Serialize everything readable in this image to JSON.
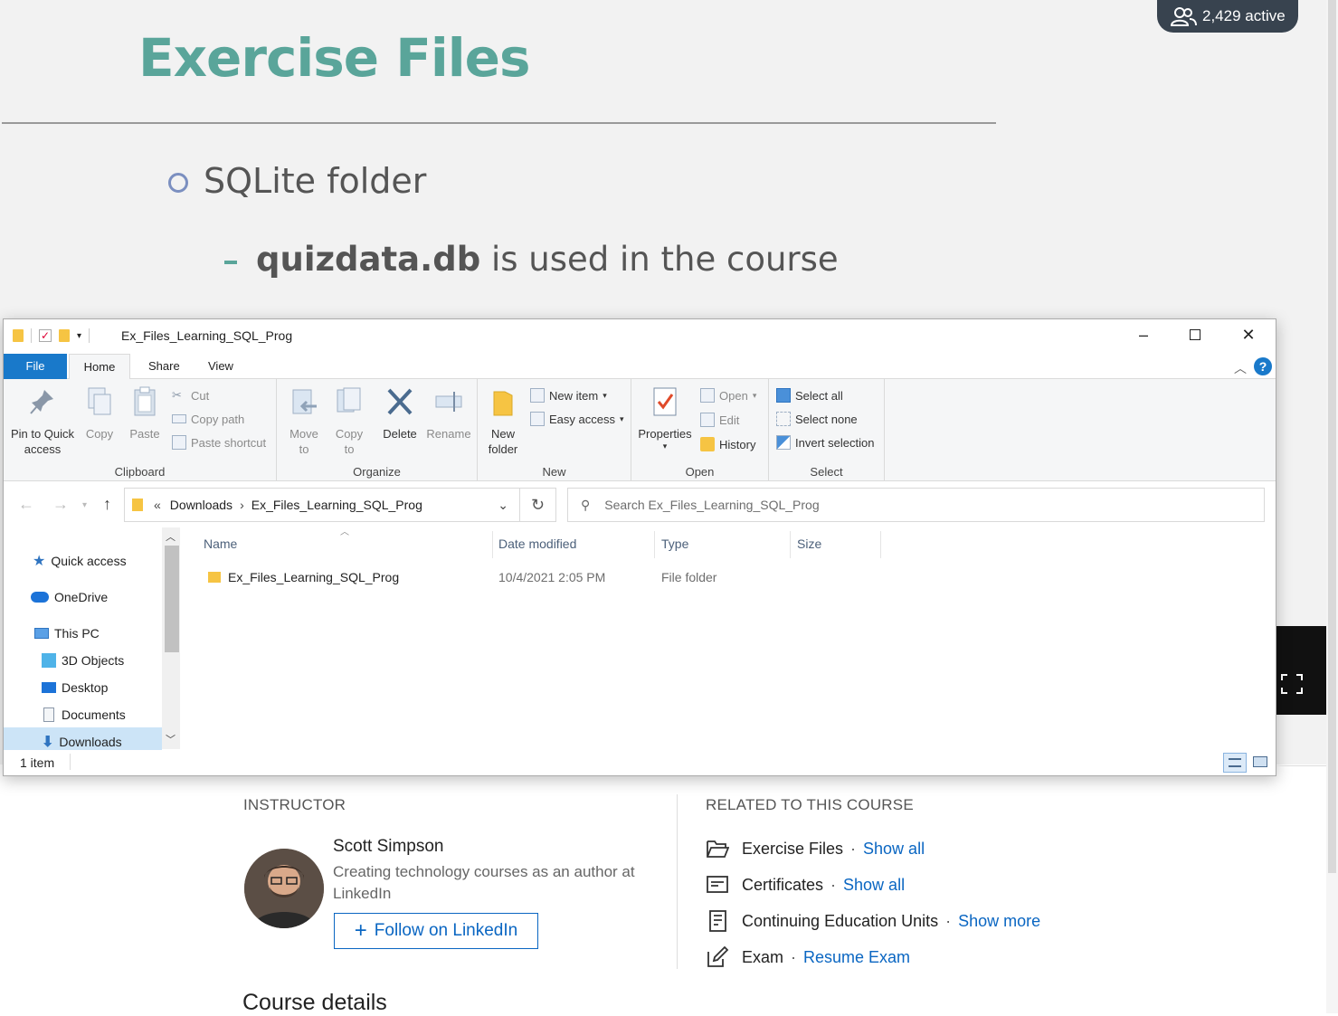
{
  "slide": {
    "title": "Exercise Files",
    "bullet1": "SQLite folder",
    "bullet2_bold": "quizdata.db",
    "bullet2_rest": " is used in the course"
  },
  "active_badge": {
    "text": "2,429 active"
  },
  "explorer": {
    "window_title": "Ex_Files_Learning_SQL_Prog",
    "tabs": {
      "file": "File",
      "home": "Home",
      "share": "Share",
      "view": "View"
    },
    "ribbon": {
      "clipboard": {
        "label": "Clipboard",
        "pin": "Pin to Quick access",
        "copy": "Copy",
        "paste": "Paste",
        "cut": "Cut",
        "copy_path": "Copy path",
        "paste_shortcut": "Paste shortcut"
      },
      "organize": {
        "label": "Organize",
        "move_to": "Move to",
        "copy_to": "Copy to",
        "delete": "Delete",
        "rename": "Rename"
      },
      "new": {
        "label": "New",
        "new_folder": "New folder",
        "new_item": "New item",
        "easy_access": "Easy access"
      },
      "open": {
        "label": "Open",
        "properties": "Properties",
        "open": "Open",
        "edit": "Edit",
        "history": "History"
      },
      "select": {
        "label": "Select",
        "select_all": "Select all",
        "select_none": "Select none",
        "invert_selection": "Invert selection"
      }
    },
    "address": {
      "prefix": "«",
      "crumb1": "Downloads",
      "crumb2": "Ex_Files_Learning_SQL_Prog",
      "search_placeholder": "Search Ex_Files_Learning_SQL_Prog"
    },
    "nav": {
      "quick_access": "Quick access",
      "onedrive": "OneDrive",
      "this_pc": "This PC",
      "objects3d": "3D Objects",
      "desktop": "Desktop",
      "documents": "Documents",
      "downloads": "Downloads"
    },
    "columns": {
      "name": "Name",
      "date": "Date modified",
      "type": "Type",
      "size": "Size"
    },
    "rows": [
      {
        "name": "Ex_Files_Learning_SQL_Prog",
        "date": "10/4/2021 2:05 PM",
        "type": "File folder",
        "size": ""
      }
    ],
    "status": "1 item"
  },
  "course": {
    "instructor_heading": "INSTRUCTOR",
    "instructor_name": "Scott Simpson",
    "instructor_bio": "Creating technology courses as an author at LinkedIn",
    "follow_label": "Follow on LinkedIn",
    "related_heading": "RELATED TO THIS COURSE",
    "related": [
      {
        "label": "Exercise Files",
        "sep": "·",
        "link": "Show all"
      },
      {
        "label": "Certificates",
        "sep": "·",
        "link": "Show all"
      },
      {
        "label": "Continuing Education Units",
        "sep": "·",
        "link": "Show more"
      },
      {
        "label": "Exam",
        "sep": "·",
        "link": "Resume Exam"
      }
    ],
    "course_details": "Course details"
  },
  "colors": {
    "accent_teal": "#5aa59a",
    "link_blue": "#0a66c2",
    "file_tab_blue": "#1979ca"
  }
}
